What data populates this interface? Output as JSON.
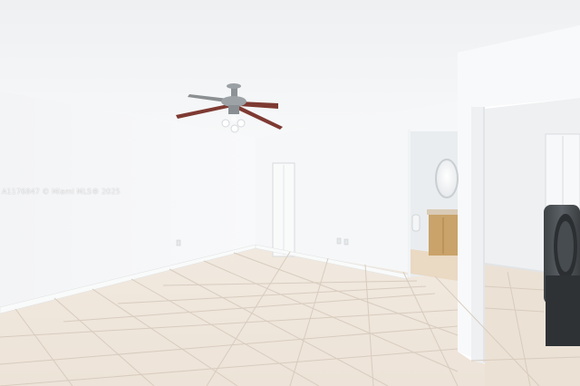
{
  "photo": {
    "watermark": "A1176847 © Miami MLS® 2025",
    "colors": {
      "ceiling": "#f4f5f6",
      "wall": "#f6f7f8",
      "wall_shadow": "#eceef0",
      "floor_tile": "#efe6dc",
      "grout": "#d8ccbe",
      "baseboard": "#f9fafa",
      "fan_blade": "#7e3a32",
      "vanity_wood": "#c9a36a",
      "washer": "#4e5357"
    }
  }
}
